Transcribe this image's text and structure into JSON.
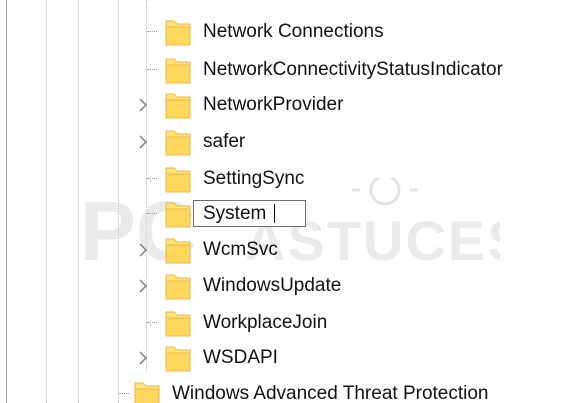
{
  "tree": {
    "items": [
      {
        "label": "Network Connections",
        "expander": false,
        "folder_icon": "folder-icon"
      },
      {
        "label": "NetworkConnectivityStatusIndicator",
        "expander": false,
        "folder_icon": "folder-icon"
      },
      {
        "label": "NetworkProvider",
        "expander": true,
        "folder_icon": "folder-icon"
      },
      {
        "label": "safer",
        "expander": true,
        "folder_icon": "folder-icon"
      },
      {
        "label": "SettingSync",
        "expander": false,
        "folder_icon": "folder-icon"
      },
      {
        "label": "System",
        "expander": false,
        "folder_icon": "folder-icon",
        "editing": true
      },
      {
        "label": "WcmSvc",
        "expander": true,
        "folder_icon": "folder-icon"
      },
      {
        "label": "WindowsUpdate",
        "expander": true,
        "folder_icon": "folder-icon"
      },
      {
        "label": "WorkplaceJoin",
        "expander": false,
        "folder_icon": "folder-icon"
      },
      {
        "label": "WSDAPI",
        "expander": true,
        "folder_icon": "folder-icon"
      },
      {
        "label": "Windows Advanced Threat Protection",
        "expander": false,
        "folder_icon": "folder-icon"
      }
    ]
  },
  "rename": {
    "value": "System"
  },
  "icons": {
    "expander": "chevron-right-icon",
    "folder": "folder-icon",
    "watermark": "watermark-logo"
  },
  "watermark": {
    "text": "PC ASTUCES"
  },
  "colors": {
    "folder_fill": "#FFE27A",
    "folder_stroke": "#E4B94A",
    "text": "#111111",
    "guide_lines": "#B8B8B8",
    "watermark": "#D8D8D8"
  }
}
